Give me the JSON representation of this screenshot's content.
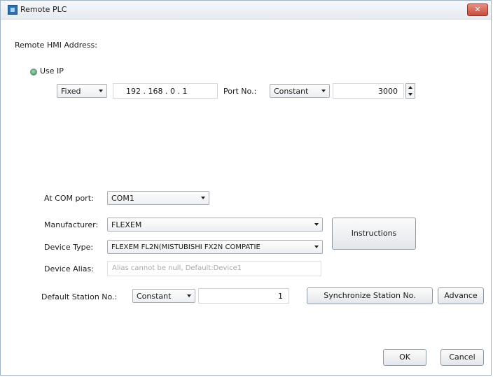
{
  "window": {
    "title": "Remote PLC"
  },
  "address": {
    "heading": "Remote HMI Address:",
    "use_ip_label": "Use IP",
    "ip_mode": "Fixed",
    "ip_address": "192 . 168 .  0  .  1",
    "port_label": "Port No.:",
    "port_mode": "Constant",
    "port_value": "3000"
  },
  "device": {
    "com_port_label": "At COM port:",
    "com_port": "COM1",
    "manufacturer_label": "Manufacturer:",
    "manufacturer": "FLEXEM",
    "device_type_label": "Device Type:",
    "device_type": "FLEXEM FL2N(MISTUBISHI FX2N COMPATIE",
    "device_alias_label": "Device Alias:",
    "device_alias_placeholder": "Alias cannot be null, Default:Device1",
    "station_label": "Default Station No.:",
    "station_mode": "Constant",
    "station_value": "1"
  },
  "buttons": {
    "instructions": "Instructions",
    "synchronize": "Synchronize Station No.",
    "advance": "Advance",
    "ok": "OK",
    "cancel": "Cancel",
    "close": "✕"
  }
}
